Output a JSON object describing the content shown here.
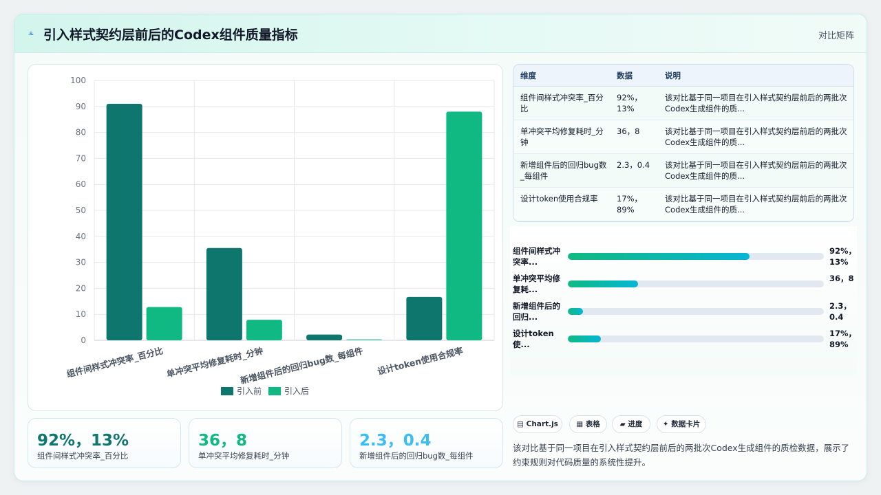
{
  "header": {
    "logo_icon": "sparkle-icon",
    "logo_glyph": "⸛",
    "title": "引入样式契约层前后的Codex组件质量指标",
    "right_label": "对比矩阵"
  },
  "chart_data": {
    "type": "bar",
    "categories": [
      "组件间样式冲突率_百分比",
      "单冲突平均修复耗时_分钟",
      "新增组件后的回归bug数_每组件",
      "设计token使用合规率"
    ],
    "series": [
      {
        "name": "引入前",
        "values": [
          91,
          35.5,
          2.2,
          16.7
        ],
        "color": "#0f766e"
      },
      {
        "name": "引入后",
        "values": [
          12.8,
          7.9,
          0.5,
          88
        ],
        "color": "#10b981"
      }
    ],
    "yticks": [
      0,
      10,
      20,
      30,
      40,
      50,
      60,
      70,
      80,
      90,
      100
    ],
    "ylim": [
      0,
      100
    ],
    "grid": true,
    "legend": "bottom"
  },
  "table": {
    "headers": [
      "维度",
      "数据",
      "说明"
    ],
    "rows": [
      {
        "dim": "组件间样式冲突率_百分比",
        "data": "92%，13%",
        "desc": "该对比基于同一项目在引入样式契约层前后的两批次Codex生成组件的质..."
      },
      {
        "dim": "单冲突平均修复耗时_分钟",
        "data": "36，8",
        "desc": "该对比基于同一项目在引入样式契约层前后的两批次Codex生成组件的质..."
      },
      {
        "dim": "新增组件后的回归bug数_每组件",
        "data": "2.3，0.4",
        "desc": "该对比基于同一项目在引入样式契约层前后的两批次Codex生成组件的质..."
      },
      {
        "dim": "设计token使用合规率",
        "data": "17%，89%",
        "desc": "该对比基于同一项目在引入样式契约层前后的两批次Codex生成组件的质..."
      }
    ]
  },
  "progress": [
    {
      "label": "组件间样式冲突率...",
      "value": "92%，13%",
      "fraction": 0.71
    },
    {
      "label": "单冲突平均修复耗...",
      "value": "36，8",
      "fraction": 0.275
    },
    {
      "label": "新增组件后的回归...",
      "value": "2.3，0.4",
      "fraction": 0.06
    },
    {
      "label": "设计token使...",
      "value": "17%，89%",
      "fraction": 0.13
    }
  ],
  "stats": [
    {
      "value": "92%，13%",
      "label": "组件间样式冲突率_百分比",
      "color": "#0f766e"
    },
    {
      "value": "36，8",
      "label": "单冲突平均修复耗时_分钟",
      "color": "#10b981"
    },
    {
      "value": "2.3，0.4",
      "label": "新增组件后的回归bug数_每组件",
      "color": "#38bdf8"
    }
  ],
  "tags": [
    {
      "label": "▤ Chart.js",
      "icon": "chart-icon"
    },
    {
      "label": "▦ 表格",
      "icon": "table-icon"
    },
    {
      "label": "▰ 进度",
      "icon": "progress-icon"
    },
    {
      "label": "✦ 数据卡片",
      "icon": "card-icon"
    }
  ],
  "summary": "该对比基于同一项目在引入样式契约层前后的两批次Codex生成组件的质检数据，展示了约束规则对代码质量的系统性提升。"
}
